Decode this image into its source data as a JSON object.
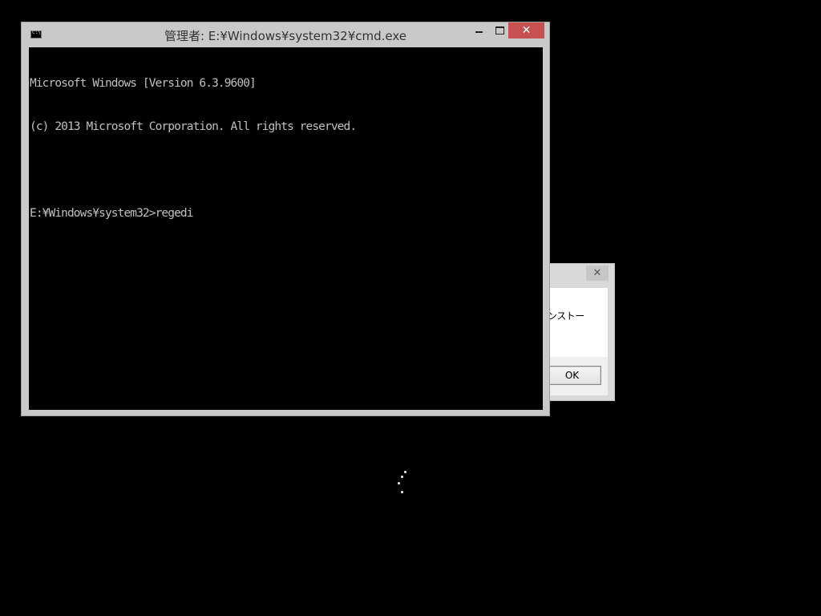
{
  "dialog": {
    "close_glyph": "✕",
    "message": "ンストー",
    "ok_label": "OK"
  },
  "cmd": {
    "title": "管理者: E:¥Windows¥system32¥cmd.exe",
    "icon": "console-icon",
    "close_glyph": "✕",
    "lines": [
      "Microsoft Windows [Version 6.3.9600]",
      "(c) 2013 Microsoft Corporation. All rights reserved.",
      "",
      "E:¥Windows¥system32>regedi"
    ]
  },
  "colors": {
    "desktop": "#000000",
    "close_button": "#c75050",
    "console_text": "#c0c0c0"
  },
  "spinner": {
    "icon": "busy-spinner-icon"
  }
}
